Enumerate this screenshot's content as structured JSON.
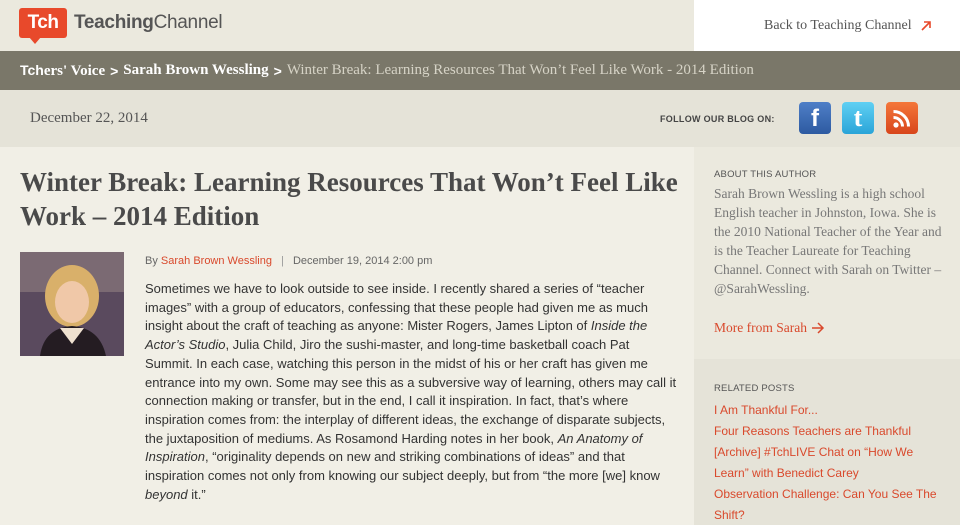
{
  "header": {
    "logo_badge": "Tch",
    "logo_text_bold": "Teaching",
    "logo_text_rest": "Channel",
    "back_link": "Back to Teaching Channel"
  },
  "breadcrumb": {
    "tch": "Tch",
    "root": "ers' Voice",
    "sep1": ">",
    "author": "Sarah Brown Wessling",
    "sep2": ">",
    "current": "Winter Break: Learning Resources That Won’t Feel Like Work - 2014 Edition"
  },
  "datebar": {
    "date": "December 22, 2014",
    "follow_label": "FOLLOW OUR BLOG ON:",
    "facebook": "f",
    "twitter": "t"
  },
  "article": {
    "title": "Winter Break: Learning Resources That Won’t Feel Like Work – 2014 Edition",
    "by": "By",
    "author": "Sarah Brown Wessling",
    "divider": "|",
    "posted": "December 19, 2014 2:00 pm",
    "body": {
      "p1": "Sometimes we have to look outside to see inside. I recently shared a series of “teacher images” with a group of educators, confessing that these people had given me as much insight about the craft of teaching as anyone: Mister Rogers, James Lipton of ",
      "i1": "Inside the Actor’s Studio",
      "p2": ", Julia Child, Jiro the sushi-master, and long-time basketball coach Pat Summit. In each case, watching this person in the midst of his or her craft has given me entrance into my own. Some may see this as a subversive way of learning, others may call it connection making or transfer, but in the end, I call it inspiration. In fact, that’s where inspiration comes from: the interplay of different ideas, the exchange of disparate subjects, the juxtaposition of mediums. As Rosamond Harding notes in her book, ",
      "i2": "An Anatomy of Inspiration",
      "p3": ", “originality depends on new and striking combinations of ideas” and that inspiration comes not only from knowing our subject deeply, but from “the more [we] know ",
      "i3": "beyond",
      "p4": " it.”"
    }
  },
  "sidebar": {
    "about_heading": "ABOUT THIS AUTHOR",
    "about_text": "Sarah Brown Wessling is a high school English teacher in Johnston, Iowa. She is the 2010 National Teacher of the Year and is the Teacher Laureate for Teaching Channel. Connect with Sarah on Twitter – @SarahWessling.",
    "more_from": "More from Sarah",
    "related_heading": "RELATED POSTS",
    "related": [
      "I Am Thankful For...",
      "Four Reasons Teachers are Thankful",
      "[Archive] #TchLIVE Chat on “How We Learn” with Benedict Carey",
      "Observation Challenge: Can You See The Shift?"
    ]
  },
  "colors": {
    "brand_red": "#e8492b",
    "link_red": "#d9492c",
    "crumb_bar": "#7a7769"
  }
}
